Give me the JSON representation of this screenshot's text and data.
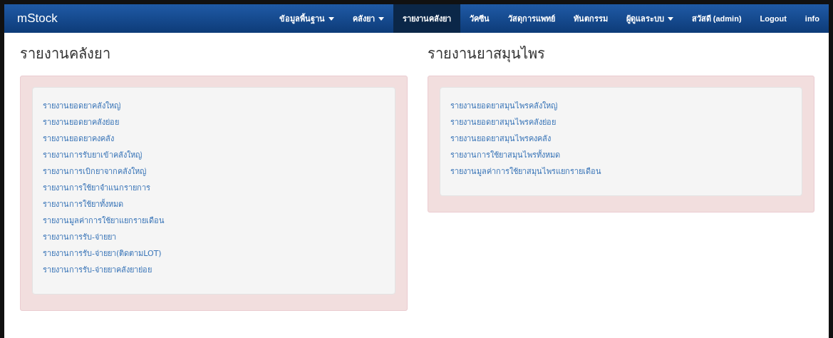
{
  "navbar": {
    "brand": "mStock",
    "items": [
      {
        "label": "ข้อมูลพื้นฐาน",
        "dropdown": true,
        "selected": false
      },
      {
        "label": "คลังยา",
        "dropdown": true,
        "selected": false
      },
      {
        "label": "รายงานคลังยา",
        "dropdown": false,
        "selected": true
      },
      {
        "label": "วัคซีน",
        "dropdown": false,
        "selected": false
      },
      {
        "label": "วัสดุการแพทย์",
        "dropdown": false,
        "selected": false
      },
      {
        "label": "ทันตกรรม",
        "dropdown": false,
        "selected": false
      },
      {
        "label": "ผู้ดูแลระบบ",
        "dropdown": true,
        "selected": false
      },
      {
        "label": "สวัสดี (admin)",
        "dropdown": false,
        "selected": false
      },
      {
        "label": "Logout",
        "dropdown": false,
        "selected": false
      },
      {
        "label": "info",
        "dropdown": false,
        "selected": false
      }
    ]
  },
  "sections": [
    {
      "title": "รายงานคลังยา",
      "links": [
        "รายงานยอดยาคลังใหญ่",
        "รายงานยอดยาคลังย่อย",
        "รายงานยอดยาคงคลัง",
        "รายงานการรับยาเข้าคลังใหญ่",
        "รายงานการเบิกยาจากคลังใหญ่",
        "รายงานการใช้ยาจำแนกรายการ",
        "รายงานการใช้ยาทั้งหมด",
        "รายงานมูลค่าการใช้ยาแยกรายเดือน",
        "รายงานการรับ-จ่ายยา",
        "รายงานการรับ-จ่ายยา(ติดตามLOT)",
        "รายงานการรับ-จ่ายยาคลังยาย่อย"
      ]
    },
    {
      "title": "รายงานยาสมุนไพร",
      "links": [
        "รายงานยอดยาสมุนไพรคลังใหญ่",
        "รายงานยอดยาสมุนไพรคลังย่อย",
        "รายงานยอดยาสมุนไพรคงคลัง",
        "รายงานการใช้ยาสมุนไพรทั้งหมด",
        "รายงานมูลค่าการใช้ยาสมุนไพรแยกรายเดือน"
      ]
    }
  ]
}
